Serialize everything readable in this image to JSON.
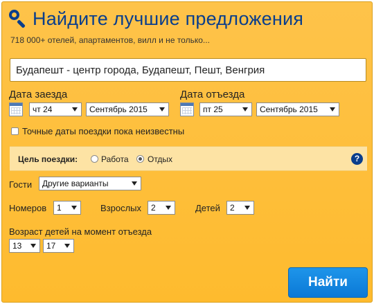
{
  "header": {
    "title": "Найдите лучшие предложения",
    "subtitle": "718 000+ отелей, апартаментов, вилл и не только..."
  },
  "destination": {
    "value": "Будапешт - центр города, Будапешт, Пешт, Венгрия"
  },
  "checkin": {
    "label": "Дата заезда",
    "day": "чт 24",
    "month": "Сентябрь 2015"
  },
  "checkout": {
    "label": "Дата отъезда",
    "day": "пт 25",
    "month": "Сентябрь 2015"
  },
  "flexible_dates": {
    "label": "Точные даты поездки пока неизвестны",
    "checked": false
  },
  "trip_purpose": {
    "label": "Цель поездки:",
    "options": [
      {
        "label": "Работа",
        "checked": false
      },
      {
        "label": "Отдых",
        "checked": true
      }
    ],
    "help": "?"
  },
  "guests": {
    "label": "Гости",
    "value": "Другие варианты"
  },
  "rooms": {
    "label": "Номеров",
    "value": "1"
  },
  "adults": {
    "label": "Взрослых",
    "value": "2"
  },
  "children": {
    "label": "Детей",
    "value": "2"
  },
  "children_ages": {
    "label": "Возраст детей на момент отъезда",
    "values": [
      "13",
      "17"
    ]
  },
  "search_button": {
    "label": "Найти"
  },
  "colors": {
    "panel": "#febb2e",
    "title": "#0a3e8c",
    "button": "#0b79d6",
    "purpose_bar": "#fde3a4"
  },
  "icons": {
    "search": "magnifier-icon",
    "calendar": "calendar-icon",
    "help": "question-circle-icon"
  }
}
